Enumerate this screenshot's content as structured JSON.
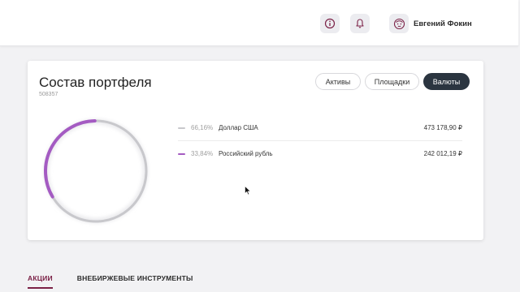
{
  "header": {
    "user_name": "Евгений Фокин",
    "icons": [
      "info-icon",
      "bell-icon",
      "avatar-face-icon"
    ]
  },
  "portfolio": {
    "title": "Состав портфеля",
    "account_id": "508357",
    "segments": [
      {
        "label": "Активы",
        "active": false
      },
      {
        "label": "Площадки",
        "active": false
      },
      {
        "label": "Валюты",
        "active": true
      }
    ],
    "items": [
      {
        "percent": "66,16%",
        "name": "Доллар США",
        "amount": "473 178,90 ₽",
        "color": "#c8c8cc"
      },
      {
        "percent": "33,84%",
        "name": "Российский рубль",
        "amount": "242 012,19 ₽",
        "color": "#9b59b6"
      }
    ]
  },
  "chart_data": {
    "type": "pie",
    "categories": [
      "Доллар США",
      "Российский рубль"
    ],
    "values": [
      66.16,
      33.84
    ],
    "colors": [
      "#c8c8cc",
      "#a45bc2"
    ]
  },
  "tabs": [
    {
      "label": "АКЦИИ",
      "active": true
    },
    {
      "label": "ВНЕБИРЖЕВЫЕ ИНСТРУМЕНТЫ",
      "active": false
    }
  ],
  "theme": {
    "accent": "#7b2146",
    "dark_button": "#2b3540"
  }
}
